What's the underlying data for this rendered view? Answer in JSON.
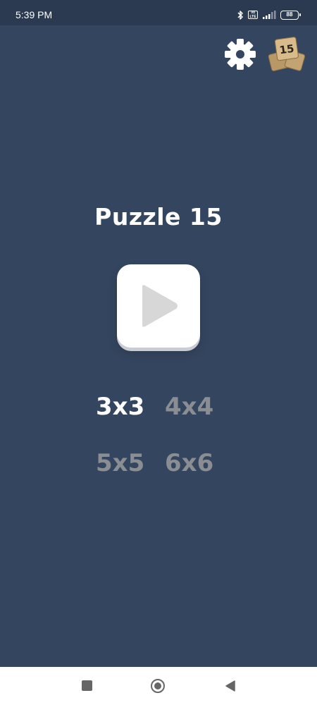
{
  "status_bar": {
    "time": "5:39 PM",
    "volte_top": "Vo",
    "volte_bottom": "LTE",
    "battery_level": "88",
    "icons": [
      "bluetooth-icon",
      "volte-icon",
      "signal-icon",
      "battery-icon"
    ]
  },
  "header": {
    "settings_icon": "gear-icon",
    "tiles_icon": "tiles-15-icon",
    "tile_label": "15"
  },
  "main": {
    "title": "Puzzle 15",
    "play_icon": "play-icon",
    "sizes": [
      {
        "label": "3x3",
        "selected": true
      },
      {
        "label": "4x4",
        "selected": false
      },
      {
        "label": "5x5",
        "selected": false
      },
      {
        "label": "6x6",
        "selected": false
      }
    ]
  },
  "nav_bar": {
    "icons": [
      "recents-square-icon",
      "home-circle-icon",
      "back-triangle-icon"
    ]
  },
  "colors": {
    "background": "#34465f",
    "status_bar": "#2b3a50",
    "selected_text": "#ffffff",
    "dim_text": "#8a8e93",
    "play_triangle": "#d7d7d7"
  }
}
